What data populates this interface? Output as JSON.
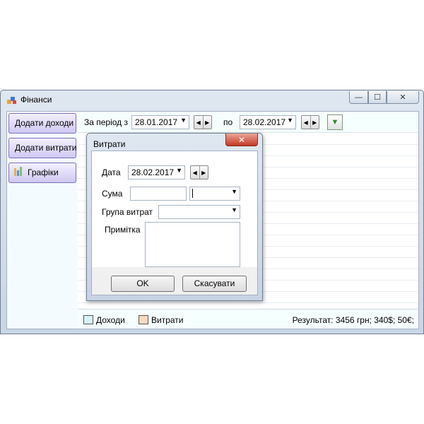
{
  "main_window": {
    "title": "Фінанси",
    "caption": {
      "minimize": "—",
      "maximize": "☐",
      "close": "✕"
    },
    "sidebar": [
      {
        "label": "Додати доходи"
      },
      {
        "label": "Додати витрати"
      },
      {
        "label": "Графіки",
        "icon": "chart-icon"
      }
    ],
    "filter": {
      "period_from_label": "За період з",
      "date_from": "28.01.2017",
      "to_label": "по",
      "date_to": "28.02.2017"
    },
    "status": {
      "legend_income": "Доходи",
      "legend_expense": "Витрати",
      "result": "Результат: 3456 грн; 340$; 50€;"
    }
  },
  "dialog": {
    "title": "Витрати",
    "close": "✕",
    "date_label": "Дата",
    "date_value": "28.02.2017",
    "amount_label": "Сума",
    "amount_value": "",
    "currency_value": "",
    "group_label": "Група витрат",
    "group_value": "",
    "note_label": "Примітка",
    "note_value": "",
    "ok_label": "OK",
    "cancel_label": "Скасувати"
  },
  "colors": {
    "income_legend": "#d8f3f8",
    "expense_legend": "#fbd9bd",
    "dialog_close": "#c43a25",
    "sidebar_button": "#cfc8f3"
  }
}
